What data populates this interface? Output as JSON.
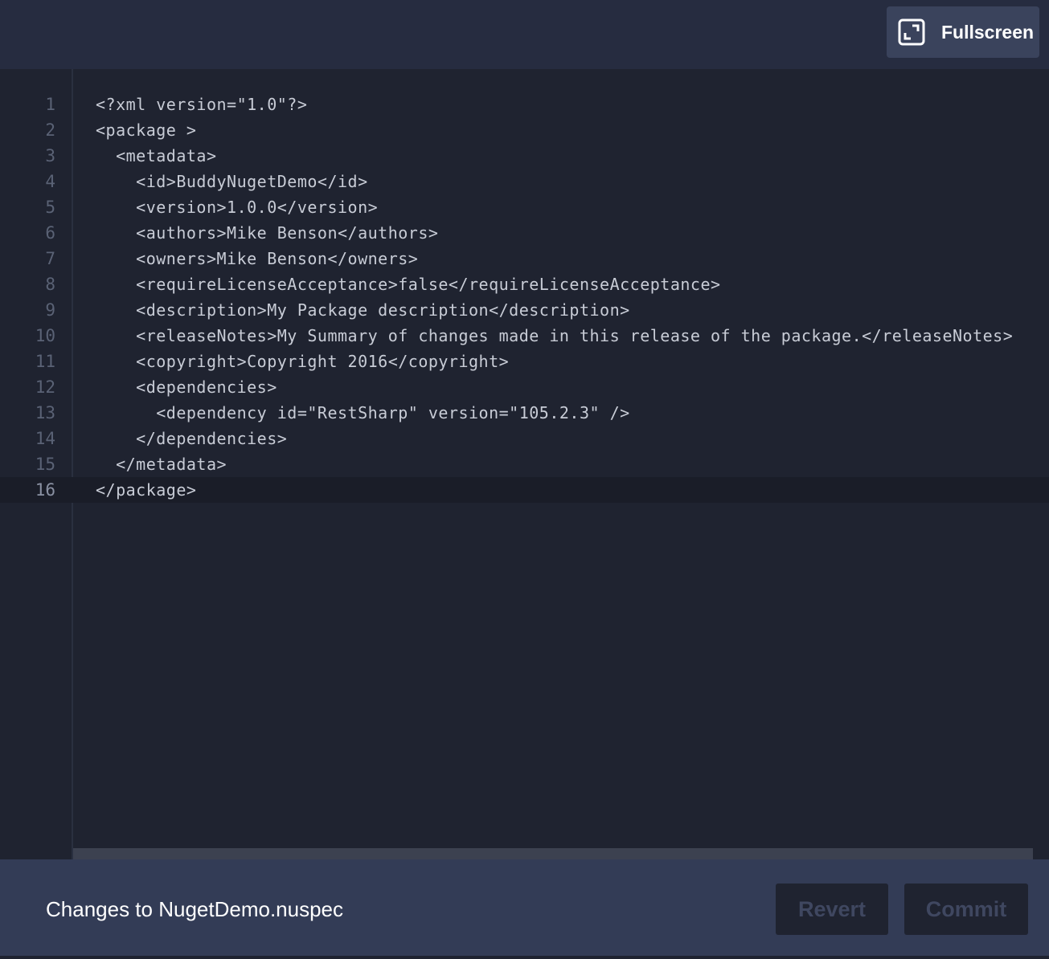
{
  "toolbar": {
    "fullscreen_label": "Fullscreen",
    "fullscreen_icon": "expand-icon"
  },
  "editor": {
    "active_line": 16,
    "lines": [
      {
        "num": "1",
        "text": "<?xml version=\"1.0\"?>"
      },
      {
        "num": "2",
        "text": "<package >"
      },
      {
        "num": "3",
        "text": "  <metadata>"
      },
      {
        "num": "4",
        "text": "    <id>BuddyNugetDemo</id>"
      },
      {
        "num": "5",
        "text": "    <version>1.0.0</version>"
      },
      {
        "num": "6",
        "text": "    <authors>Mike Benson</authors>"
      },
      {
        "num": "7",
        "text": "    <owners>Mike Benson</owners>"
      },
      {
        "num": "8",
        "text": "    <requireLicenseAcceptance>false</requireLicenseAcceptance>"
      },
      {
        "num": "9",
        "text": "    <description>My Package description</description>"
      },
      {
        "num": "10",
        "text": "    <releaseNotes>My Summary of changes made in this release of the package.</releaseNotes>"
      },
      {
        "num": "11",
        "text": "    <copyright>Copyright 2016</copyright>"
      },
      {
        "num": "12",
        "text": "    <dependencies>"
      },
      {
        "num": "13",
        "text": "      <dependency id=\"RestSharp\" version=\"105.2.3\" />"
      },
      {
        "num": "14",
        "text": "    </dependencies>"
      },
      {
        "num": "15",
        "text": "  </metadata>"
      },
      {
        "num": "16",
        "text": "</package>"
      }
    ]
  },
  "footer": {
    "title": "Changes to NugetDemo.nuspec",
    "revert_label": "Revert",
    "commit_label": "Commit"
  },
  "colors": {
    "background": "#1f2330",
    "topbar": "#262c40",
    "footer": "#333c56",
    "button_disabled_text": "#3f4760"
  }
}
